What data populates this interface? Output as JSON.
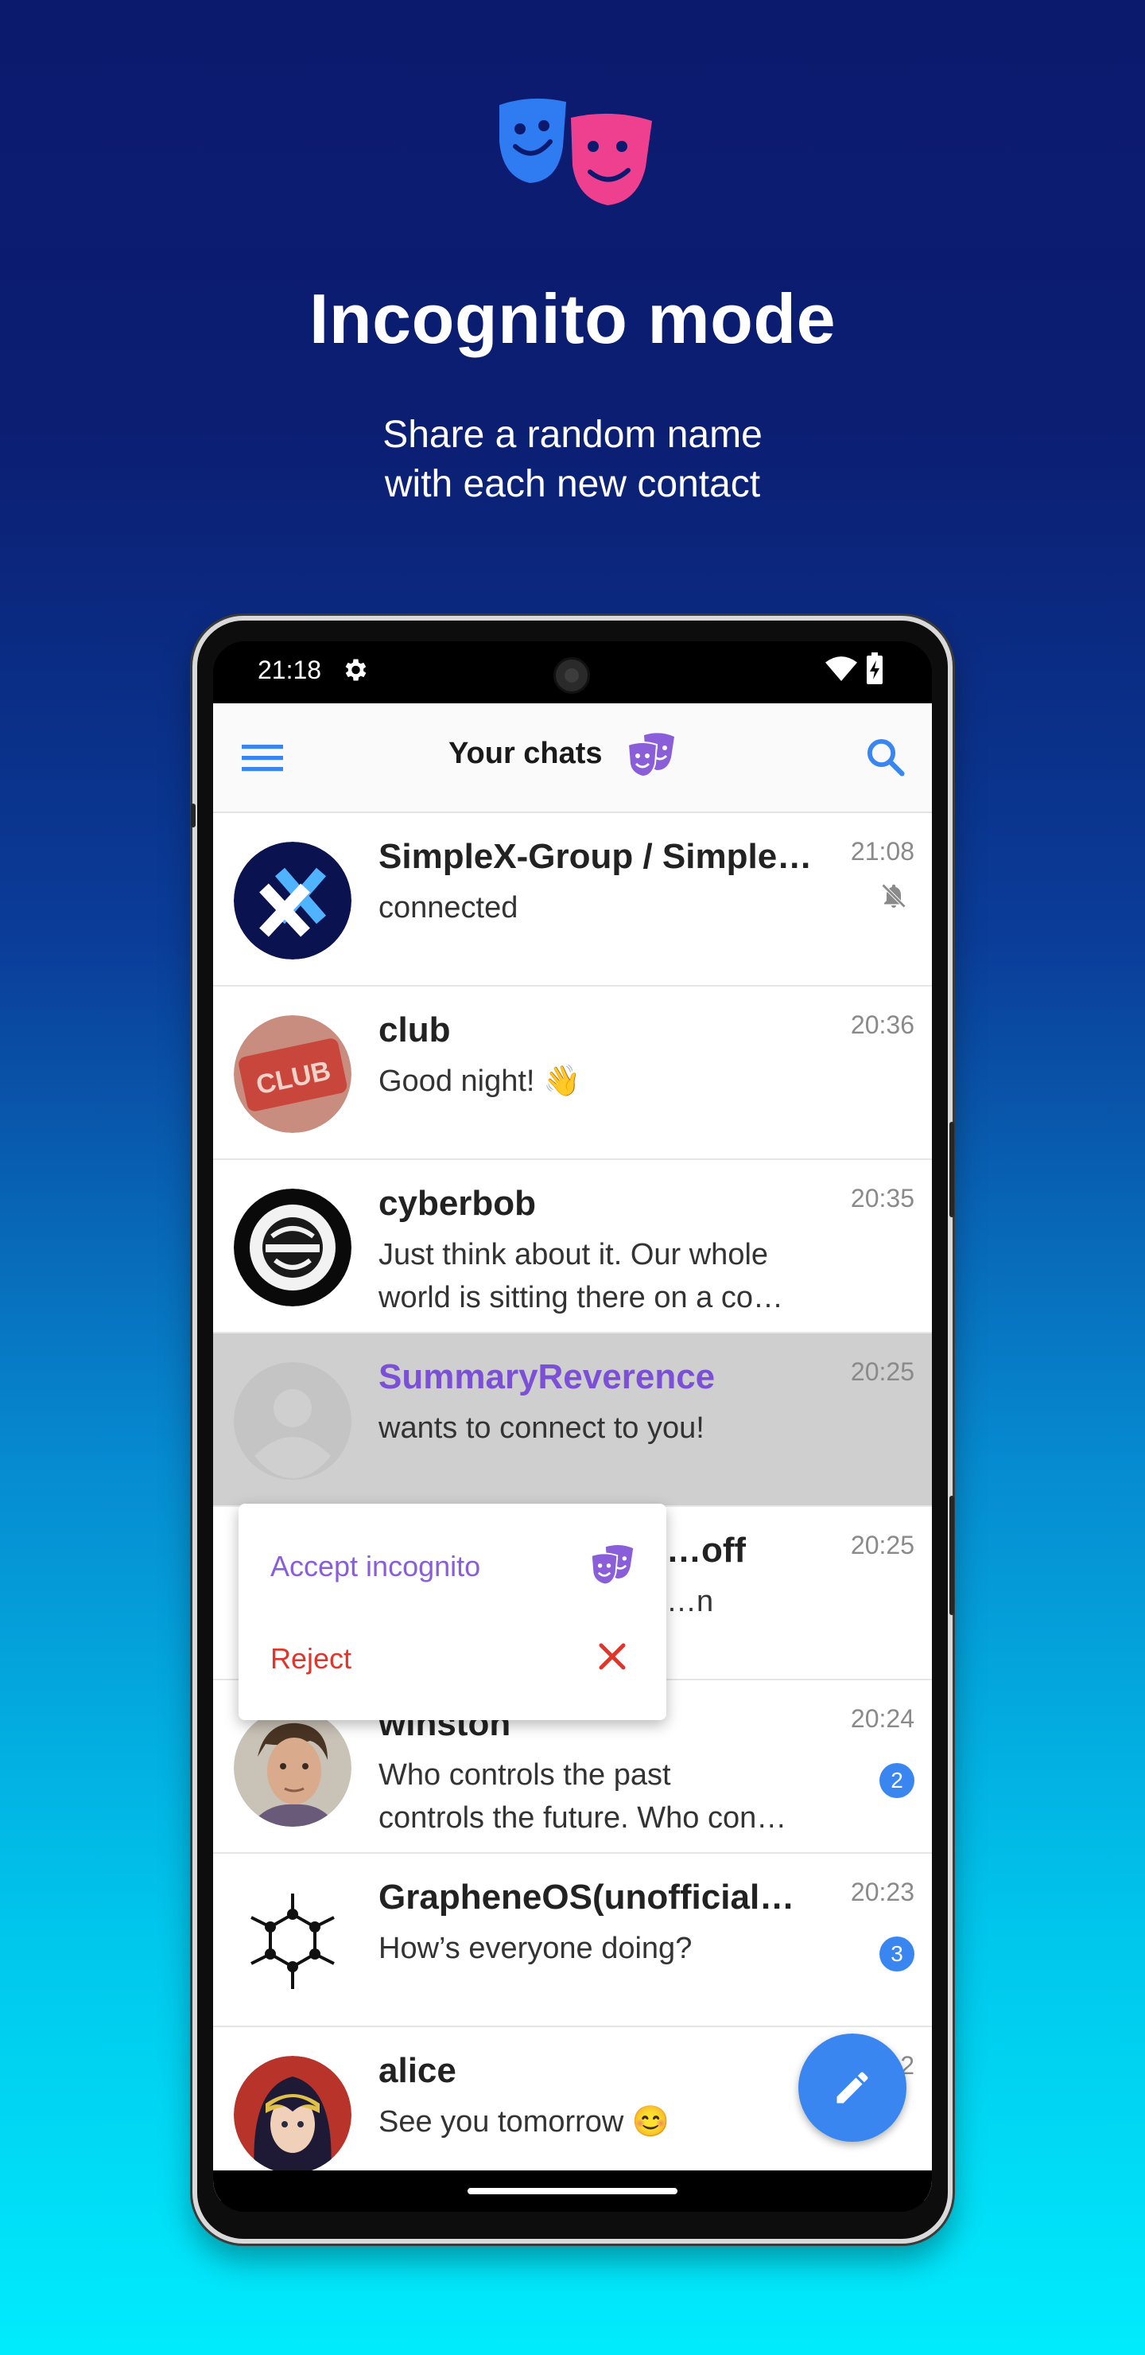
{
  "hero": {
    "logo_icon": "incognito-masks-icon",
    "title": "Incognito mode",
    "subtitle_lines": [
      "Share a random name",
      "with each new contact"
    ]
  },
  "status_bar": {
    "time": "21:18",
    "icons": [
      "gear-icon",
      "wifi-icon",
      "battery-icon"
    ]
  },
  "app_bar": {
    "menu_icon": "hamburger-menu-icon",
    "title": "Your chats",
    "incognito_icon": "incognito-masks-icon",
    "search_icon": "search-icon"
  },
  "colors": {
    "accent_blue": "#3a86f0",
    "incognito_purple": "#8a5ed8",
    "reject_red": "#e0352b",
    "highlight_row": "#cfcfcf"
  },
  "chats": [
    {
      "name": "SimpleX-Group / Simple…",
      "message": [
        "connected"
      ],
      "time": "21:08",
      "muted": true,
      "unread": null
    },
    {
      "name": "club",
      "message": [
        "Good night! 👋"
      ],
      "time": "20:36",
      "muted": false,
      "unread": null
    },
    {
      "name": "cyberbob",
      "message": [
        "Just think about it. Our whole",
        "world is sitting there on a co…"
      ],
      "time": "20:35",
      "muted": false,
      "unread": null
    },
    {
      "name": "SummaryReverence",
      "message": [
        "wants to connect to you!"
      ],
      "time": "20:25",
      "muted": false,
      "unread": null,
      "highlighted": true
    },
    {
      "name": "…off",
      "message": [
        "…n"
      ],
      "time": "20:25",
      "muted": false,
      "unread": null
    },
    {
      "name": "winston",
      "message": [
        "Who controls the past",
        "controls the future. Who con…"
      ],
      "time": "20:24",
      "muted": false,
      "unread": "2"
    },
    {
      "name": "GrapheneOS(unofficial…",
      "message": [
        "How’s everyone doing?"
      ],
      "time": "20:23",
      "muted": false,
      "unread": "3"
    },
    {
      "name": "alice",
      "message": [
        "See you tomorrow 😊"
      ],
      "time": "…2",
      "muted": false,
      "unread": null
    }
  ],
  "context_menu": {
    "accept_label": "Accept incognito",
    "accept_icon": "incognito-masks-icon",
    "reject_label": "Reject",
    "reject_icon": "close-icon"
  },
  "fab": {
    "icon": "pencil-icon"
  }
}
